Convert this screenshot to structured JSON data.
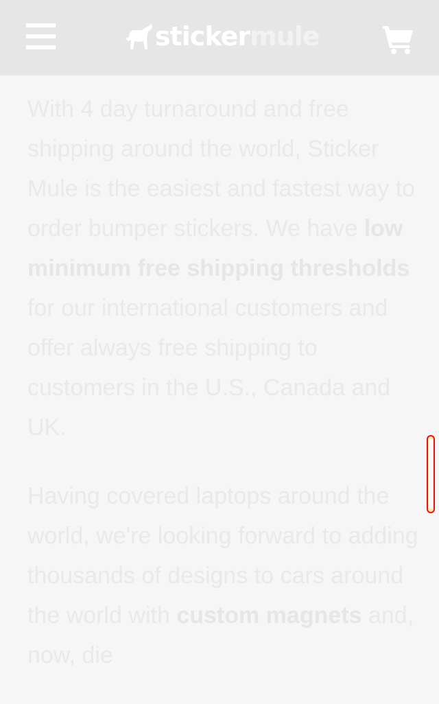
{
  "header": {
    "menu_icon": "hamburger-menu-icon",
    "logo_part1": "sticker",
    "logo_part2": "mule",
    "cart_icon": "shopping-cart-icon"
  },
  "content": {
    "p1_a": "With 4 day turnaround and free shipping around the world, Sticker Mule is the easiest and fastest way to order bumper stickers. We have ",
    "p1_bold": "low minimum free shipping thresholds",
    "p1_b": " for our international customers and offer always free shipping to customers in the U.S., Canada and UK.",
    "p2_a": "Having covered laptops around the world, we're looking forward to adding thousands of designs to cars around the world with ",
    "p2_bold": "custom magnets",
    "p2_b": " and, now, die"
  },
  "colors": {
    "header_bg": "#e6e6e6",
    "page_bg": "#f6f6f6",
    "text": "#e9e9e9",
    "scrollbar_border": "#ee1111"
  }
}
